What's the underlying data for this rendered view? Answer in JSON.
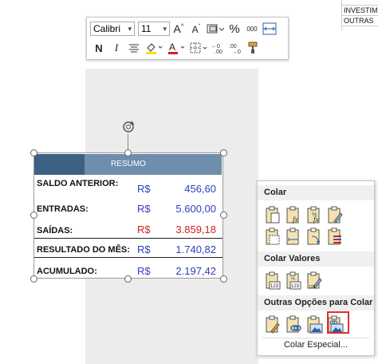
{
  "background_sheet": {
    "fragment_rows": [
      "INVESTIM",
      "OUTRAS"
    ]
  },
  "toolbar": {
    "font_name": "Calibri",
    "font_size": "11",
    "bold_label": "N",
    "italic_label": "I",
    "percent_label": "%",
    "thousands_label": "000",
    "font_color": "#d42020",
    "fill_color": "#f5e600"
  },
  "summary": {
    "header": "RESUMO",
    "header_colors": {
      "dark": "#3c6183",
      "light": "#6e8eab"
    },
    "rows": [
      {
        "label": "SALDO ANTERIOR:",
        "currency": "R$",
        "value": "456,60",
        "color": "blue"
      },
      {
        "label": "ENTRADAS:",
        "currency": "R$",
        "value": "5.600,00",
        "color": "blue"
      },
      {
        "label": "SAÍDAS:",
        "currency": "R$",
        "value": "3.859,18",
        "color": "red"
      },
      {
        "label": "RESULTADO DO MÊS:",
        "currency": "R$",
        "value": "1.740,82",
        "color": "blue"
      },
      {
        "label": "ACUMULADO:",
        "currency": "R$",
        "value": "2.197,42",
        "color": "blue"
      }
    ]
  },
  "paste_menu": {
    "section_paste": "Colar",
    "section_values": "Colar Valores",
    "section_other": "Outras Opções para Colar",
    "special": "Colar Especial..."
  }
}
